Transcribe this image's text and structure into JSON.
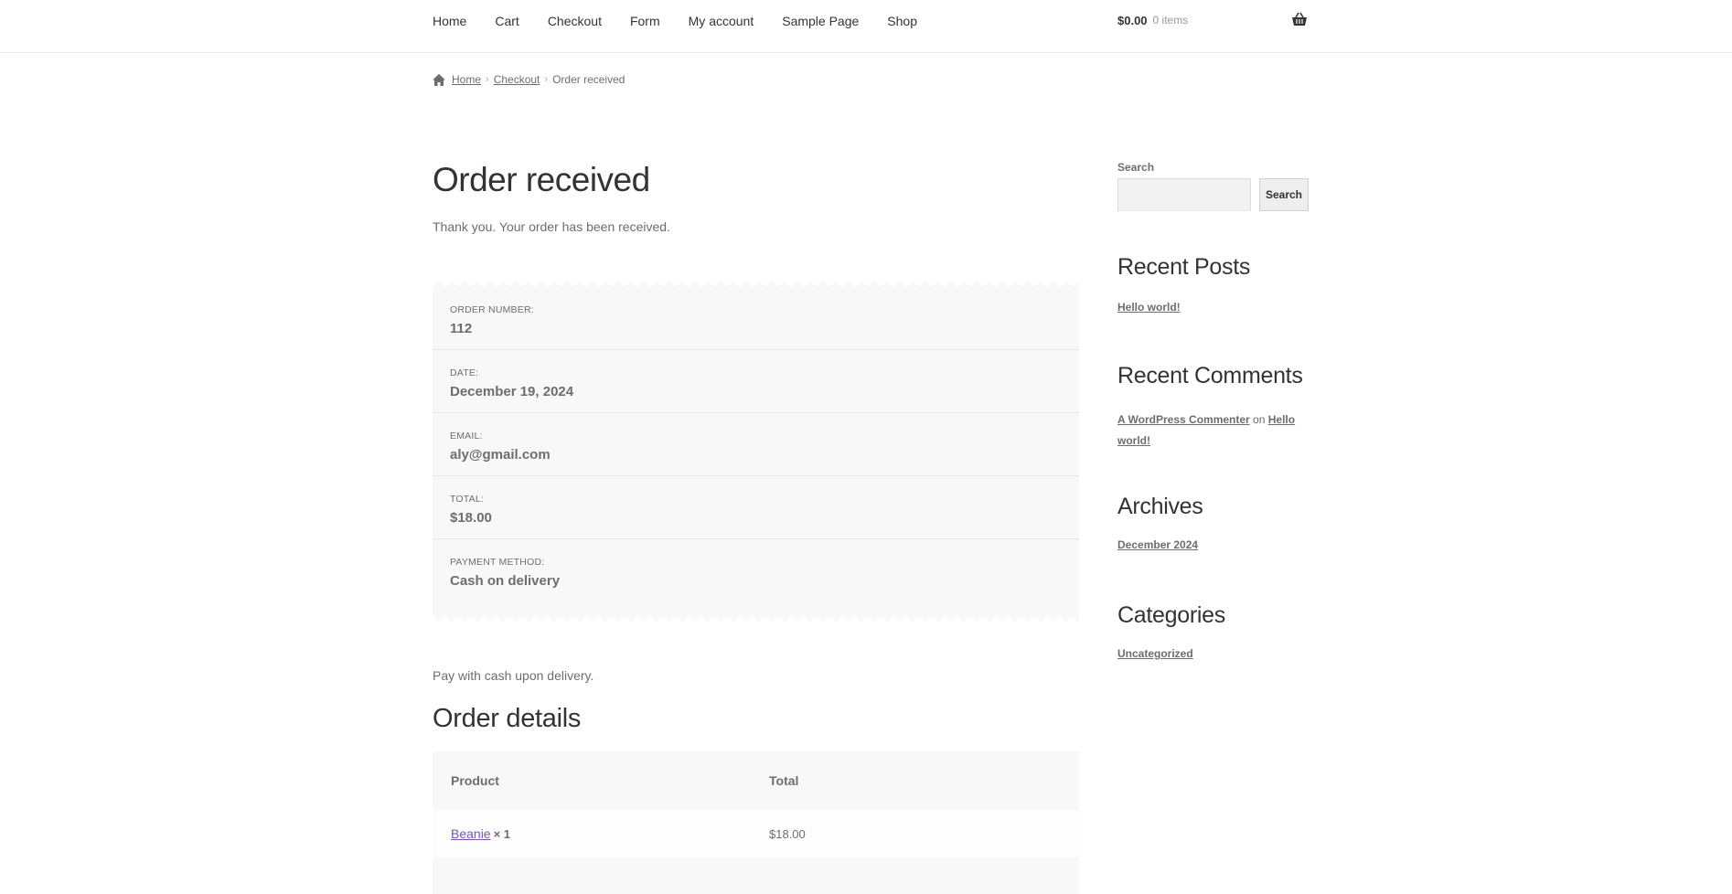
{
  "header": {
    "nav": [
      "Home",
      "Cart",
      "Checkout",
      "Form",
      "My account",
      "Sample Page",
      "Shop"
    ],
    "cart_amount": "$0.00",
    "cart_count": "0 items"
  },
  "breadcrumb": {
    "home": "Home",
    "checkout": "Checkout",
    "current": "Order received",
    "separator": "›"
  },
  "main": {
    "title": "Order received",
    "thankyou": "Thank you. Your order has been received.",
    "overview": [
      {
        "label": "Order number:",
        "value": "112"
      },
      {
        "label": "Date:",
        "value": "December 19, 2024"
      },
      {
        "label": "Email:",
        "value": "aly@gmail.com"
      },
      {
        "label": "Total:",
        "value": "$18.00"
      },
      {
        "label": "Payment method:",
        "value": "Cash on delivery"
      }
    ],
    "payment_note": "Pay with cash upon delivery.",
    "details_title": "Order details",
    "table": {
      "headers": {
        "product": "Product",
        "total": "Total"
      },
      "rows": [
        {
          "product": "Beanie",
          "qty": "× 1",
          "total": "$18.00"
        }
      ]
    }
  },
  "sidebar": {
    "search_label": "Search",
    "search_button": "Search",
    "search_placeholder": "",
    "recent_posts": {
      "title": "Recent Posts",
      "items": [
        "Hello world!"
      ]
    },
    "recent_comments": {
      "title": "Recent Comments",
      "author": "A WordPress Commenter",
      "on": "on",
      "post": "Hello world!"
    },
    "archives": {
      "title": "Archives",
      "items": [
        "December 2024"
      ]
    },
    "categories": {
      "title": "Categories",
      "items": [
        "Uncategorized"
      ]
    }
  },
  "colors": {
    "accent_link": "#7f54b3",
    "text": "#6d6d6d",
    "heading": "#333333"
  },
  "icons": {
    "home": "home-icon",
    "cart": "basket-icon"
  }
}
